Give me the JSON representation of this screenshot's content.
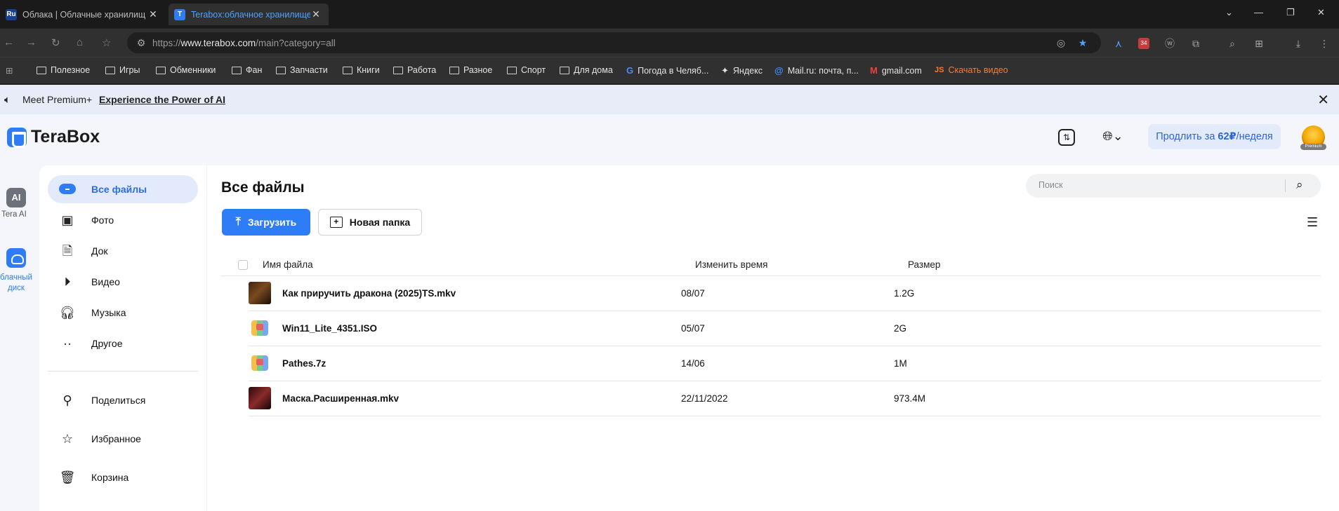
{
  "browser": {
    "tabs": [
      {
        "favicon": "Ru",
        "favicon_color": "#1b3f8f",
        "label": "Облака | Облачные хранилищ"
      },
      {
        "favicon": "T",
        "favicon_color": "#2e7df6",
        "label": "Terabox:облачное хранилище"
      }
    ],
    "url_prefix": "https://",
    "url_domain": "www.terabox.com",
    "url_path": "/main?category=all",
    "extension_badge": "34",
    "bookmarks": [
      {
        "label": "Полезное",
        "icon": "folder-icon"
      },
      {
        "label": "Игры",
        "icon": "folder-icon"
      },
      {
        "label": "Обменники",
        "icon": "folder-icon"
      },
      {
        "label": "Фан",
        "icon": "folder-icon"
      },
      {
        "label": "Запчасти",
        "icon": "folder-icon"
      },
      {
        "label": "Книги",
        "icon": "folder-icon"
      },
      {
        "label": "Работа",
        "icon": "folder-icon"
      },
      {
        "label": "Разное",
        "icon": "folder-icon"
      },
      {
        "label": "Спорт",
        "icon": "folder-icon"
      },
      {
        "label": "Для дома",
        "icon": "folder-icon"
      },
      {
        "label": "Погода в Челяб...",
        "icon": "g-icon"
      },
      {
        "label": "Яндекс",
        "icon": "sparkle-icon"
      },
      {
        "label": "Mail.ru: почта, п...",
        "icon": "at-icon"
      },
      {
        "label": "gmail.com",
        "icon": "gmail-icon"
      },
      {
        "label": "Скачать видео",
        "icon": "js-icon"
      }
    ]
  },
  "promo": {
    "text": "Meet Premium+",
    "link": "Experience the Power of AI"
  },
  "header": {
    "logo_text": "TeraBox",
    "renew_prefix": "Продлить за ",
    "renew_price": "62₽",
    "renew_suffix": "/неделя",
    "avatar_badge": "Premium"
  },
  "rail": {
    "ai_badge": "AI",
    "ai_label": "Tera AI",
    "disk_label": "блачный диск"
  },
  "sidebar": {
    "items": [
      {
        "label": "Все файлы",
        "icon": "all-files-icon"
      },
      {
        "label": "Фото",
        "icon": "photo-icon"
      },
      {
        "label": "Док",
        "icon": "doc-icon"
      },
      {
        "label": "Видео",
        "icon": "video-icon"
      },
      {
        "label": "Музыка",
        "icon": "headphones-icon"
      },
      {
        "label": "Другое",
        "icon": "more-icon"
      },
      {
        "label": "Поделиться",
        "icon": "share-icon"
      },
      {
        "label": "Избранное",
        "icon": "star-icon"
      },
      {
        "label": "Корзина",
        "icon": "trash-icon"
      }
    ]
  },
  "main": {
    "title": "Все файлы",
    "search_placeholder": "Поиск",
    "upload_label": "Загрузить",
    "new_folder_label": "Новая папка",
    "columns": {
      "name": "Имя файла",
      "time": "Изменить время",
      "size": "Размер"
    },
    "files": [
      {
        "name": "Как приручить дракона (2025)TS.mkv",
        "time": "08/07",
        "size": "1.2G",
        "thumb": "video"
      },
      {
        "name": "Win11_Lite_4351.ISO",
        "time": "05/07",
        "size": "2G",
        "thumb": "archive"
      },
      {
        "name": "Pathes.7z",
        "time": "14/06",
        "size": "1M",
        "thumb": "archive"
      },
      {
        "name": "Маска.Расширенная.mkv",
        "time": "22/11/2022",
        "size": "973.4M",
        "thumb": "video"
      }
    ]
  },
  "colors": {
    "accent": "#2e7df6",
    "active_bg": "#e2eafb",
    "promo_bg": "#e7ecf8"
  }
}
